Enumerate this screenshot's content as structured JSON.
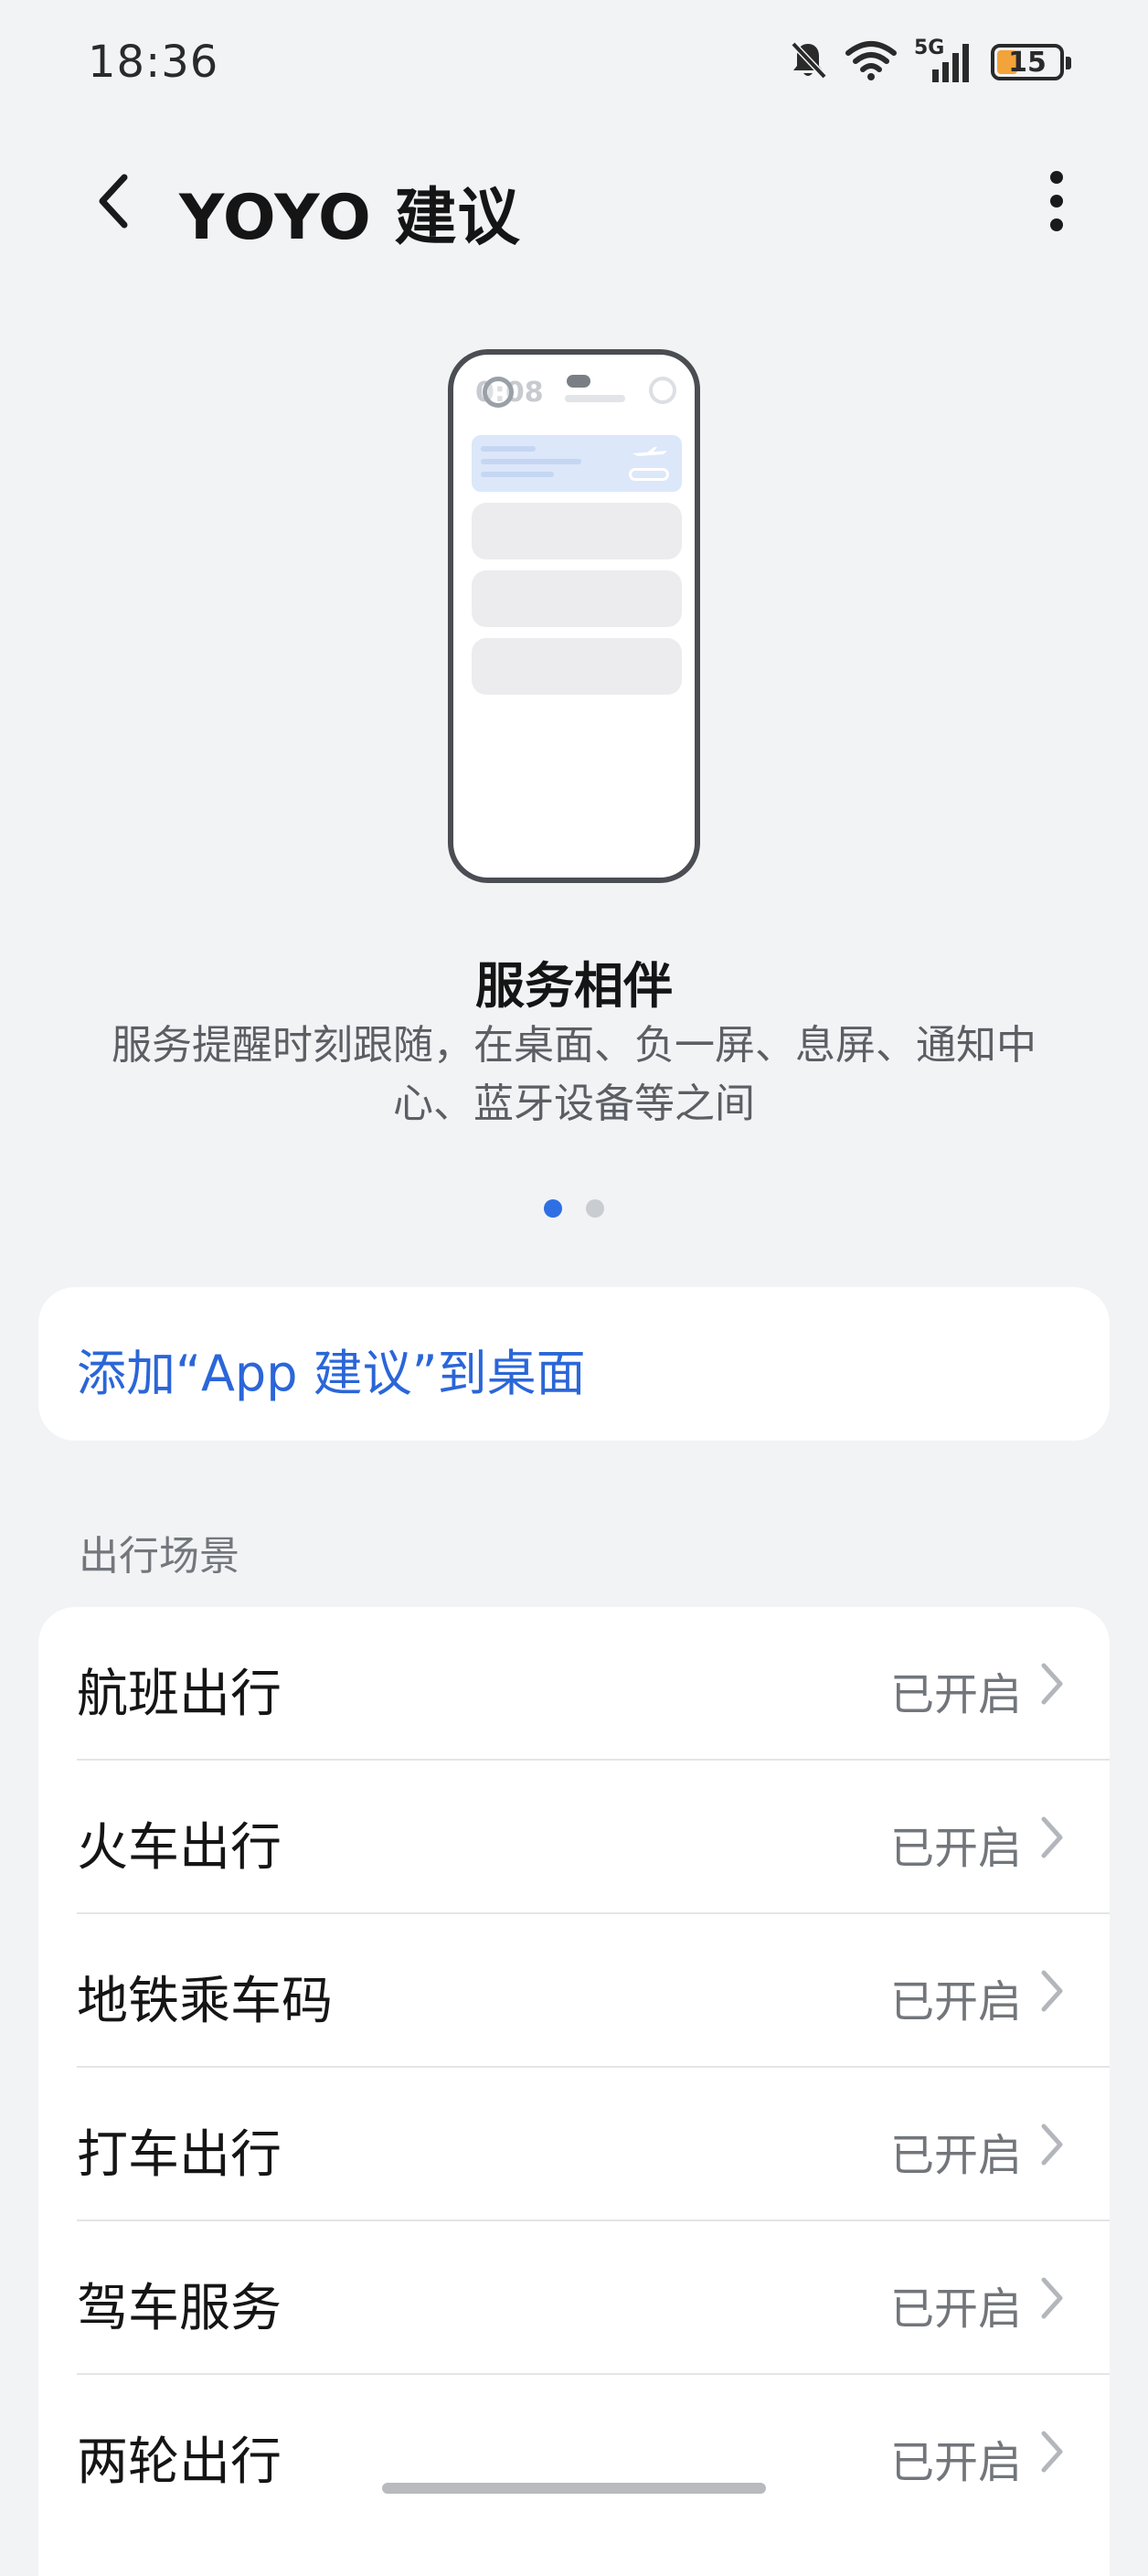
{
  "status_bar": {
    "time": "18:36",
    "network": "5G",
    "battery_level": "15",
    "battery_color": "#f2a33a",
    "icons": [
      "bell-muted-icon",
      "wifi-icon",
      "signal-icon",
      "battery-icon"
    ]
  },
  "header": {
    "title": "YOYO 建议",
    "back_icon": "chevron-left-icon",
    "more_icon": "more-vertical-icon"
  },
  "illustration": {
    "phone_time": "0:08"
  },
  "feature": {
    "title": "服务相伴",
    "description": "服务提醒时刻跟随，在桌面、负一屏、息屏、通知中心、蓝牙设备等之间"
  },
  "pager": {
    "total": 2,
    "current": 1
  },
  "add_widget": {
    "label": "添加“App 建议”到桌面",
    "accent_color": "#2b66d8"
  },
  "travel": {
    "section_title": "出行场景",
    "items": [
      {
        "label": "航班出行",
        "status": "已开启"
      },
      {
        "label": "火车出行",
        "status": "已开启"
      },
      {
        "label": "地铁乘车码",
        "status": "已开启"
      },
      {
        "label": "打车出行",
        "status": "已开启"
      },
      {
        "label": "驾车服务",
        "status": "已开启"
      },
      {
        "label": "两轮出行",
        "status": "已开启"
      }
    ]
  }
}
